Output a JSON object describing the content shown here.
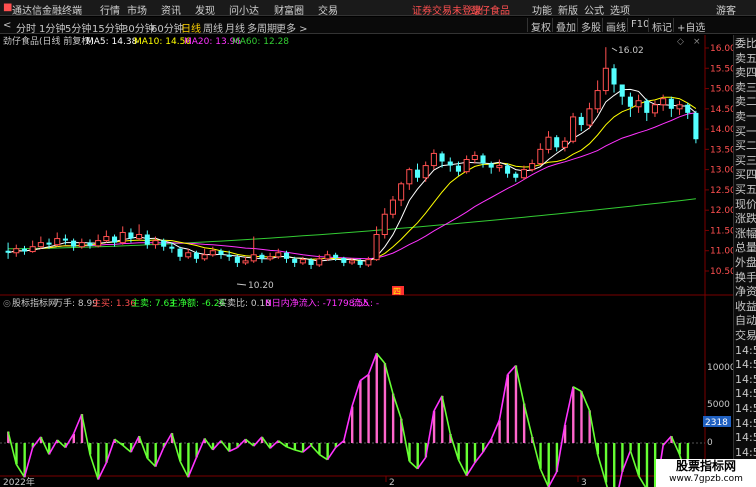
{
  "menubar": {
    "app_title": "通达信金融终端",
    "menus": [
      "行情",
      "市场",
      "资讯",
      "发现",
      "问小达",
      "财富圈",
      "交易"
    ],
    "notice": "证券交易未登录",
    "stock_name": "劲仔食品",
    "right_menus": [
      "功能",
      "新版",
      "公式",
      "选项"
    ],
    "user": "游客"
  },
  "toolbar": {
    "timeframes": [
      "分时",
      "1分钟",
      "5分钟",
      "15分钟",
      "30分钟",
      "60分钟",
      "日线",
      "周线",
      "月线",
      "多周期",
      "更多 >"
    ],
    "active_timeframe": "日线",
    "buttons": [
      "复权",
      "叠加",
      "多股",
      "画线",
      "F10",
      "标记",
      "+自选"
    ],
    "back_arrow": "<"
  },
  "main_chart": {
    "title": "劲仔食品(日线 前复权)",
    "ma_labels": [
      {
        "text": "MA5: 14.38",
        "color": "#ffffff"
      },
      {
        "text": "MA10: 14.56",
        "color": "#ffff00"
      },
      {
        "text": "MA20: 13.96",
        "color": "#ff33ff"
      },
      {
        "text": "MA60: 12.28",
        "color": "#33cc33"
      }
    ],
    "high_marker": "16.02",
    "low_marker": "10.20",
    "corner_icons": [
      "◇",
      "×"
    ],
    "badge": "四"
  },
  "price_axis": [
    "16.00",
    "15.50",
    "15.00",
    "14.50",
    "14.00",
    "13.50",
    "13.00",
    "12.50",
    "12.00",
    "11.50",
    "11.00",
    "10.50"
  ],
  "indicator": {
    "name": "股标指标网",
    "prefix": "万手: 8.99",
    "items": [
      {
        "text": "主买: 1.36",
        "color": "#ff5050"
      },
      {
        "text": "主卖: 7.63",
        "color": "#33ff33"
      },
      {
        "text": "主净额: -6.26",
        "color": "#33ff33"
      },
      {
        "text": "买卖比: 0.18",
        "color": "#c8c8c8"
      },
      {
        "text": "N日内净流入: -71798.55",
        "color": "#ff33ff"
      },
      {
        "text": "流入: -",
        "color": "#ff33ff"
      }
    ],
    "axis": [
      "10000",
      "5000",
      "0"
    ],
    "value_badge": "2318"
  },
  "x_axis": {
    "labels": [
      "2022年",
      "2",
      "3"
    ]
  },
  "sidebar": {
    "items": [
      "委比",
      "卖五",
      "卖四",
      "卖三",
      "卖二",
      "卖一",
      "买一",
      "买二",
      "买三",
      "买四",
      "买五",
      "现价",
      "涨跌",
      "涨幅",
      "总量",
      "外盘",
      "换手",
      "净资",
      "收益",
      "自动",
      "交易",
      "14:50",
      "14:50",
      "14:50",
      "14:50",
      "14:50",
      "14:50",
      "14:50",
      "14:50",
      "14:50"
    ]
  },
  "watermark": {
    "line1": "股票指标网",
    "line2": "www.7gpzb.com"
  },
  "colors": {
    "up": "#ff5050",
    "down": "#54ffff",
    "ma5": "#ffffff",
    "ma10": "#ffff00",
    "ma20": "#ff33ff",
    "ma60": "#33cc33",
    "osc_up": "#ff66cc",
    "osc_down": "#66ff33"
  },
  "chart_data": {
    "type": "candlestick",
    "ylim": [
      10.0,
      16.3
    ],
    "candles": [
      [
        11.0,
        10.95,
        11.2,
        10.8
      ],
      [
        10.95,
        11.05,
        11.15,
        10.85
      ],
      [
        11.05,
        10.98,
        11.12,
        10.9
      ],
      [
        10.98,
        11.1,
        11.25,
        10.95
      ],
      [
        11.1,
        11.2,
        11.35,
        11.05
      ],
      [
        11.2,
        11.15,
        11.3,
        11.05
      ],
      [
        11.15,
        11.3,
        11.45,
        11.1
      ],
      [
        11.3,
        11.25,
        11.4,
        11.15
      ],
      [
        11.25,
        11.1,
        11.3,
        11.0
      ],
      [
        11.1,
        11.2,
        11.3,
        11.05
      ],
      [
        11.2,
        11.12,
        11.28,
        11.05
      ],
      [
        11.12,
        11.25,
        11.4,
        11.08
      ],
      [
        11.25,
        11.35,
        11.5,
        11.2
      ],
      [
        11.35,
        11.2,
        11.4,
        11.1
      ],
      [
        11.2,
        11.45,
        11.6,
        11.15
      ],
      [
        11.45,
        11.3,
        11.55,
        11.2
      ],
      [
        11.3,
        11.4,
        11.65,
        11.25
      ],
      [
        11.4,
        11.15,
        11.5,
        11.05
      ],
      [
        11.15,
        11.25,
        11.35,
        11.05
      ],
      [
        11.25,
        11.1,
        11.3,
        11.0
      ],
      [
        11.1,
        11.05,
        11.2,
        10.95
      ],
      [
        11.05,
        10.85,
        11.1,
        10.75
      ],
      [
        10.85,
        10.95,
        11.05,
        10.8
      ],
      [
        10.95,
        10.8,
        11.0,
        10.7
      ],
      [
        10.8,
        10.9,
        11.05,
        10.75
      ],
      [
        10.9,
        11.0,
        11.1,
        10.85
      ],
      [
        11.0,
        10.9,
        11.05,
        10.8
      ],
      [
        10.9,
        10.85,
        11.0,
        10.75
      ],
      [
        10.85,
        10.7,
        10.9,
        10.6
      ],
      [
        10.7,
        10.75,
        10.85,
        10.65
      ],
      [
        10.75,
        10.9,
        11.35,
        10.7
      ],
      [
        10.9,
        10.8,
        10.95,
        10.7
      ],
      [
        10.8,
        10.85,
        10.95,
        10.75
      ],
      [
        10.85,
        10.95,
        11.05,
        10.8
      ],
      [
        10.95,
        10.8,
        11.0,
        10.7
      ],
      [
        10.8,
        10.7,
        10.85,
        10.6
      ],
      [
        10.7,
        10.78,
        10.85,
        10.65
      ],
      [
        10.78,
        10.65,
        10.82,
        10.55
      ],
      [
        10.65,
        10.8,
        10.9,
        10.6
      ],
      [
        10.8,
        10.9,
        11.0,
        10.75
      ],
      [
        10.9,
        10.82,
        10.95,
        10.75
      ],
      [
        10.82,
        10.7,
        10.85,
        10.62
      ],
      [
        10.7,
        10.75,
        10.82,
        10.65
      ],
      [
        10.75,
        10.65,
        10.8,
        10.58
      ],
      [
        10.65,
        10.78,
        10.85,
        10.6
      ],
      [
        10.78,
        11.4,
        11.6,
        10.75
      ],
      [
        11.4,
        11.9,
        12.05,
        11.3
      ],
      [
        11.9,
        12.25,
        12.35,
        11.8
      ],
      [
        12.25,
        12.65,
        12.7,
        12.1
      ],
      [
        12.65,
        13.0,
        13.05,
        12.5
      ],
      [
        13.0,
        12.8,
        13.15,
        12.7
      ],
      [
        12.8,
        13.1,
        13.2,
        12.7
      ],
      [
        13.1,
        13.4,
        13.5,
        13.0
      ],
      [
        13.4,
        13.2,
        13.45,
        13.05
      ],
      [
        13.2,
        13.1,
        13.3,
        12.95
      ],
      [
        13.1,
        12.95,
        13.2,
        12.85
      ],
      [
        12.95,
        13.25,
        13.35,
        12.9
      ],
      [
        13.25,
        13.35,
        13.45,
        13.15
      ],
      [
        13.35,
        13.15,
        13.4,
        13.05
      ],
      [
        13.15,
        13.05,
        13.2,
        12.9
      ],
      [
        13.05,
        13.1,
        13.25,
        12.95
      ],
      [
        13.1,
        12.9,
        13.15,
        12.8
      ],
      [
        12.9,
        12.8,
        12.95,
        12.7
      ],
      [
        12.8,
        13.0,
        13.1,
        12.75
      ],
      [
        13.0,
        13.15,
        13.25,
        12.95
      ],
      [
        13.15,
        13.5,
        13.65,
        13.1
      ],
      [
        13.5,
        13.8,
        13.95,
        13.4
      ],
      [
        13.8,
        13.55,
        13.85,
        13.45
      ],
      [
        13.55,
        13.7,
        13.8,
        13.45
      ],
      [
        13.7,
        14.3,
        14.4,
        13.65
      ],
      [
        14.3,
        14.1,
        14.4,
        13.95
      ],
      [
        14.1,
        14.5,
        14.65,
        14.0
      ],
      [
        14.5,
        14.95,
        15.2,
        14.4
      ],
      [
        14.95,
        15.5,
        16.02,
        14.85
      ],
      [
        15.5,
        15.1,
        15.6,
        14.9
      ],
      [
        15.1,
        14.8,
        15.1,
        14.6
      ],
      [
        14.8,
        14.55,
        14.9,
        14.3
      ],
      [
        14.55,
        14.7,
        14.85,
        14.4
      ],
      [
        14.7,
        14.4,
        14.75,
        14.2
      ],
      [
        14.4,
        14.6,
        14.7,
        14.3
      ],
      [
        14.6,
        14.75,
        14.85,
        14.45
      ],
      [
        14.75,
        14.5,
        14.8,
        14.3
      ],
      [
        14.5,
        14.6,
        14.7,
        14.35
      ],
      [
        14.6,
        14.4,
        14.65,
        14.25
      ],
      [
        14.4,
        13.75,
        14.45,
        13.65
      ]
    ],
    "ma60_start": 11.05,
    "ma60_end": 12.28,
    "oscillator": [
      1500,
      -2800,
      -4500,
      -600,
      800,
      -1500,
      400,
      -600,
      1200,
      3800,
      -1500,
      -4800,
      -2600,
      500,
      -300,
      -1200,
      900,
      -2000,
      -3100,
      -600,
      1300,
      -2400,
      -4500,
      -1900,
      600,
      -900,
      300,
      -1100,
      -600,
      500,
      -400,
      800,
      -700,
      300,
      -500,
      -900,
      -1200,
      -300,
      -1500,
      -2200,
      -600,
      300,
      4800,
      8200,
      9000,
      11800,
      10500,
      6500,
      3200,
      -2400,
      -3400,
      -1900,
      4200,
      6200,
      1200,
      -2200,
      -4300,
      -2600,
      -1200,
      500,
      3000,
      9000,
      10200,
      5200,
      800,
      -3400,
      -5800,
      -3800,
      2400,
      7400,
      6800,
      4300,
      -1500,
      -5200,
      -8800,
      -3800,
      -1000,
      -4300,
      -6100,
      -7200,
      -300,
      900,
      -1500,
      -5000
    ],
    "osc_ylim": [
      -9500,
      12500
    ]
  }
}
